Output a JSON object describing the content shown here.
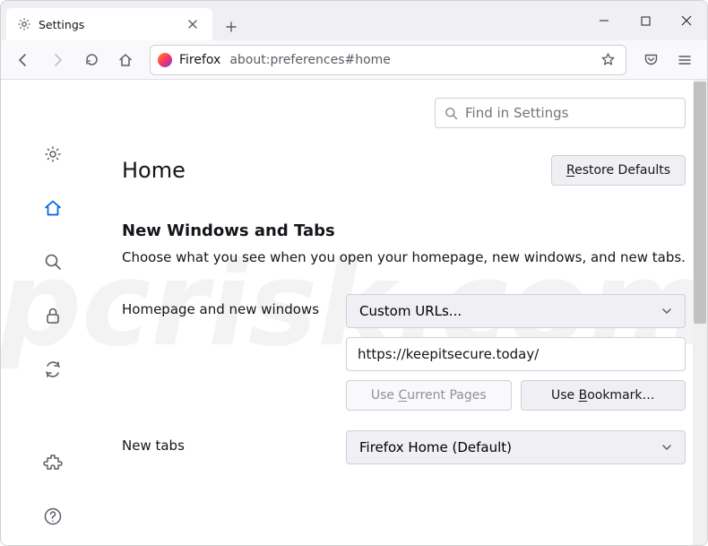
{
  "window": {
    "min": "−",
    "max": "□",
    "close": "✕"
  },
  "tab": {
    "title": "Settings"
  },
  "urlbar": {
    "brand": "Firefox",
    "url": "about:preferences#home"
  },
  "search": {
    "placeholder": "Find in Settings"
  },
  "page": {
    "heading": "Home",
    "restore": "Restore Defaults",
    "section_title": "New Windows and Tabs",
    "section_desc": "Choose what you see when you open your homepage, new windows, and new tabs."
  },
  "homepage": {
    "label": "Homepage and new windows",
    "mode": "Custom URLs...",
    "url_value": "https://keepitsecure.today/",
    "use_current_pre": "Use ",
    "use_current_mid": "C",
    "use_current_post": "urrent Pages",
    "use_bookmark_pre": "Use ",
    "use_bookmark_mid": "B",
    "use_bookmark_post": "ookmark…"
  },
  "newtabs": {
    "label": "New tabs",
    "value": "Firefox Home (Default)"
  },
  "restore_pre": "R",
  "restore_post": "estore Defaults",
  "watermark": "pcrisk.com"
}
